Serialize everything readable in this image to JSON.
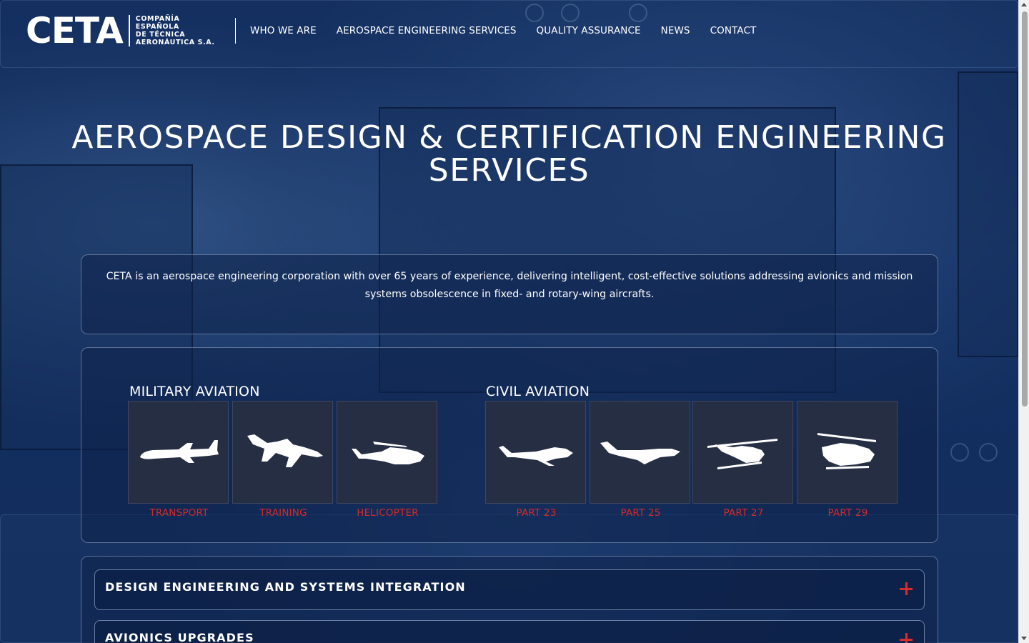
{
  "header": {
    "logo_mark": "CETA",
    "logo_lines": [
      "COMPAÑÍA",
      "ESPAÑOLA",
      "DE TÉCNICA",
      "AERONÁUTICA S.A."
    ],
    "nav": [
      {
        "label": "WHO WE ARE"
      },
      {
        "label": "AEROSPACE ENGINEERING SERVICES"
      },
      {
        "label": "QUALITY ASSURANCE"
      },
      {
        "label": "NEWS"
      },
      {
        "label": "CONTACT"
      }
    ]
  },
  "hero": {
    "title_line1": "AEROSPACE DESIGN & CERTIFICATION ENGINEERING",
    "title_line2": "SERVICES"
  },
  "intro": {
    "text": "CETA is an aerospace engineering corporation with over 65 years of experience, delivering intelligent, cost-effective solutions addressing avionics and mission systems obsolescence in fixed- and rotary-wing aircrafts."
  },
  "categories": {
    "military": {
      "title": "MILITARY AVIATION",
      "items": [
        {
          "label": "TRANSPORT",
          "icon": "transport-plane-icon"
        },
        {
          "label": "TRAINING",
          "icon": "training-jet-icon"
        },
        {
          "label": "HELICOPTER",
          "icon": "attack-helicopter-icon"
        }
      ]
    },
    "civil": {
      "title": "CIVIL AVIATION",
      "items": [
        {
          "label": "PART 23",
          "icon": "light-aircraft-icon"
        },
        {
          "label": "PART 25",
          "icon": "business-jet-icon"
        },
        {
          "label": "PART 27",
          "icon": "light-helicopter-icon"
        },
        {
          "label": "PART 29",
          "icon": "heavy-helicopter-icon"
        }
      ]
    }
  },
  "accordion": [
    {
      "title": "DESIGN ENGINEERING AND SYSTEMS INTEGRATION"
    },
    {
      "title": "AVIONICS UPGRADES"
    }
  ],
  "colors": {
    "accent_red": "#d42a2a",
    "tile_bg": "#262e44",
    "page_bg": "#112b5b"
  }
}
